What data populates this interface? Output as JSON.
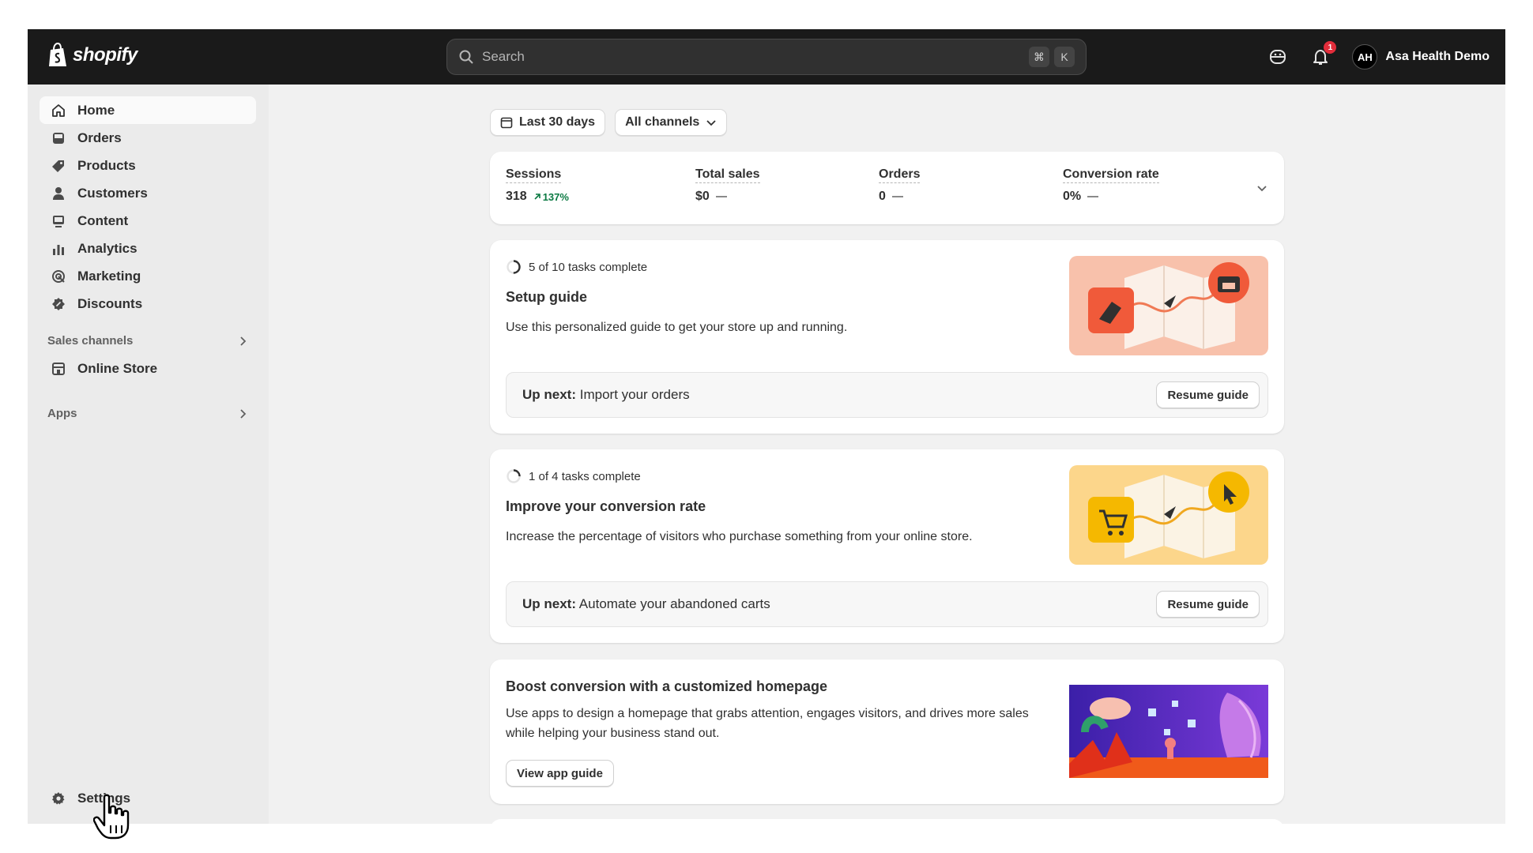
{
  "brand": {
    "name": "shopify"
  },
  "search": {
    "placeholder": "Search",
    "shortcut_cmd": "⌘",
    "shortcut_key": "K"
  },
  "topbar": {
    "notification_count": "1",
    "store_name": "Asa Health Demo",
    "store_initials": "AH"
  },
  "sidebar": {
    "items": [
      {
        "label": "Home",
        "icon": "home-icon",
        "active": true
      },
      {
        "label": "Orders",
        "icon": "inbox-icon"
      },
      {
        "label": "Products",
        "icon": "tag-icon"
      },
      {
        "label": "Customers",
        "icon": "person-icon"
      },
      {
        "label": "Content",
        "icon": "image-icon"
      },
      {
        "label": "Analytics",
        "icon": "bar-chart-icon"
      },
      {
        "label": "Marketing",
        "icon": "target-icon"
      },
      {
        "label": "Discounts",
        "icon": "discount-icon"
      }
    ],
    "sales_channels": {
      "label": "Sales channels",
      "items": [
        {
          "label": "Online Store",
          "icon": "store-icon"
        }
      ]
    },
    "apps": {
      "label": "Apps"
    },
    "settings": {
      "label": "Settings",
      "icon": "gear-icon"
    }
  },
  "filters": {
    "date_range": "Last 30 days",
    "channels": "All channels"
  },
  "metrics": [
    {
      "label": "Sessions",
      "value": "318",
      "delta": "137%",
      "trend": "up"
    },
    {
      "label": "Total sales",
      "value": "$0",
      "trend": "none"
    },
    {
      "label": "Orders",
      "value": "0",
      "trend": "none"
    },
    {
      "label": "Conversion rate",
      "value": "0%",
      "trend": "none"
    }
  ],
  "setup_guide": {
    "progress": "5 of 10 tasks complete",
    "progress_fraction": 0.5,
    "title": "Setup guide",
    "description": "Use this personalized guide to get your store up and running.",
    "up_next_label": "Up next:",
    "up_next_task": "Import your orders",
    "button": "Resume guide"
  },
  "conversion_guide": {
    "progress": "1 of 4 tasks complete",
    "progress_fraction": 0.25,
    "title": "Improve your conversion rate",
    "description": "Increase the percentage of visitors who purchase something from your online store.",
    "up_next_label": "Up next:",
    "up_next_task": "Automate your abandoned carts",
    "button": "Resume guide"
  },
  "boost": {
    "title": "Boost conversion with a customized homepage",
    "description": "Use apps to design a homepage that grabs attention, engages visitors, and drives more sales while helping your business stand out.",
    "button": "View app guide"
  }
}
